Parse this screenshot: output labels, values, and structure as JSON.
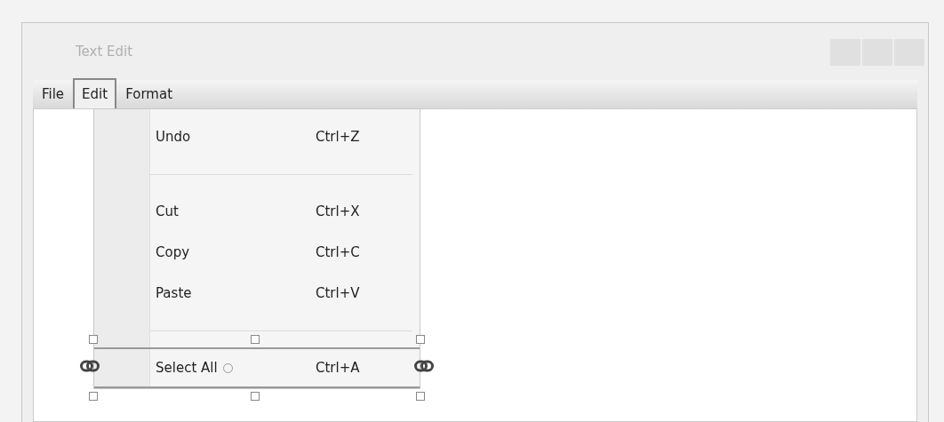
{
  "window": {
    "title": "Text Edit"
  },
  "menu_bar": [
    {
      "label": "File",
      "selected": false
    },
    {
      "label": "Edit",
      "selected": true
    },
    {
      "label": "Format",
      "selected": false
    }
  ],
  "edit_menu": {
    "items": [
      {
        "kind": "item",
        "label": "Undo",
        "shortcut": "Ctrl+Z",
        "selected": false
      },
      {
        "kind": "separator"
      },
      {
        "kind": "item",
        "label": "Cut",
        "shortcut": "Ctrl+X",
        "selected": false
      },
      {
        "kind": "item",
        "label": "Copy",
        "shortcut": "Ctrl+C",
        "selected": false
      },
      {
        "kind": "item",
        "label": "Paste",
        "shortcut": "Ctrl+V",
        "selected": false
      },
      {
        "kind": "separator"
      },
      {
        "kind": "item",
        "label": "Select All",
        "shortcut": "Ctrl+A",
        "selected": true
      }
    ]
  }
}
